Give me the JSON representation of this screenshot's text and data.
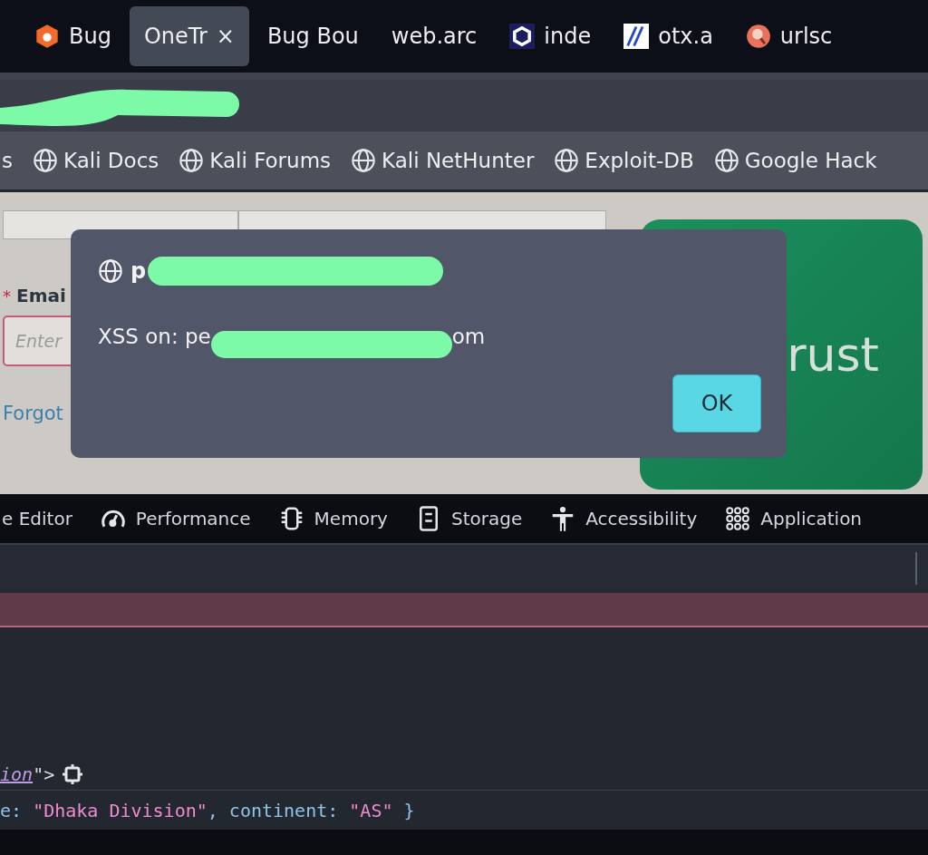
{
  "tabs": [
    {
      "label": "Bug",
      "selected": false
    },
    {
      "label": "OneTr",
      "selected": true,
      "close": "×"
    },
    {
      "label": "Bug Bou",
      "selected": false
    },
    {
      "label": "web.arc",
      "selected": false
    },
    {
      "label": "inde",
      "selected": false
    },
    {
      "label": "otx.a",
      "selected": false
    },
    {
      "label": "urlsc",
      "selected": false
    }
  ],
  "bookmarks": [
    "s",
    "Kali Docs",
    "Kali Forums",
    "Kali NetHunter",
    "Exploit-DB",
    "Google Hack"
  ],
  "page": {
    "email_label": "Emai",
    "required_mark": "*",
    "email_placeholder": "Enter",
    "forgot_link": "Forgot",
    "brand_text": "rust"
  },
  "dialog": {
    "title": "p",
    "message_start": "XSS on: pe",
    "message_end": "om",
    "ok_button": "OK"
  },
  "devtools": {
    "tabs": [
      "e Editor",
      "Performance",
      "Memory",
      "Storage",
      "Accessibility",
      "Application"
    ],
    "console_lines": [
      [
        {
          "kind": "link",
          "text": "ion"
        },
        {
          "kind": "punct",
          "text": "\">"
        }
      ],
      [
        {
          "kind": "key",
          "text": "e: "
        },
        {
          "kind": "string",
          "text": "\"Dhaka Division\""
        },
        {
          "kind": "key",
          "text": ", continent: "
        },
        {
          "kind": "string",
          "text": "\"AS\""
        },
        {
          "kind": "key",
          "text": " }"
        }
      ]
    ]
  }
}
